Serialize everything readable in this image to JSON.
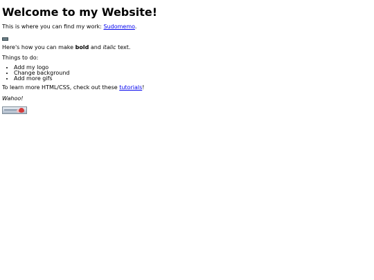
{
  "page": {
    "title": "Welcome to my Website!",
    "intro_text": "This is where you can find my work: ",
    "intro_link": "Sudomemo",
    "intro_end": ".",
    "bold_prefix": "Here's how you can make ",
    "bold_word": "bold",
    "bold_and": " and ",
    "italic_word": "italic",
    "bold_suffix": " text.",
    "todo_heading": "Things to do:",
    "todo_items": [
      "Add my logo",
      "Change background",
      "Add more gifs"
    ],
    "learn_prefix": "To learn more HTML/CSS, check out these ",
    "learn_link": "tutorials",
    "learn_suffix": "!",
    "wahoo": "Wahoo!"
  },
  "colors": {
    "link": "#0000ee",
    "text": "#000000",
    "background": "#ffffff"
  }
}
